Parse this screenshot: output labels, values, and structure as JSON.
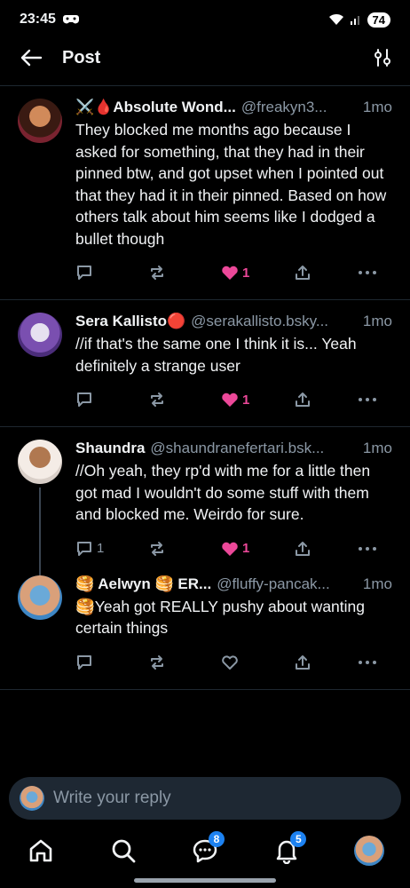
{
  "status": {
    "time": "23:45",
    "battery": "74"
  },
  "header": {
    "title": "Post"
  },
  "posts": [
    {
      "name": "⚔️🩸Absolute Wond...",
      "handle": "@freakyn3...",
      "time": "1mo",
      "text": "They blocked me months ago because I asked for something, that they had in their pinned btw, and got upset when I pointed out that they had it in their pinned. Based on how others talk about him seems like I dodged a bullet though",
      "reply_count": "",
      "like_count": "1",
      "liked": true
    },
    {
      "name": "Sera Kallisto🔴",
      "handle": "@serakallisto.bsky...",
      "time": "1mo",
      "text": "//if that's the same one I think it is... Yeah definitely a strange user",
      "reply_count": "",
      "like_count": "1",
      "liked": true
    },
    {
      "name": "Shaundra",
      "handle": "@shaundranefertari.bsk...",
      "time": "1mo",
      "text": "//Oh yeah, they rp'd with me for a little then got mad I wouldn't do some stuff with them and blocked me. Weirdo for sure.",
      "reply_count": "1",
      "like_count": "1",
      "liked": true
    },
    {
      "name": "🥞 Aelwyn 🥞 ER...",
      "handle": "@fluffy-pancak...",
      "time": "1mo",
      "text": "🥞Yeah got REALLY pushy about wanting certain things",
      "reply_count": "",
      "like_count": "",
      "liked": false
    }
  ],
  "reply": {
    "placeholder": "Write your reply"
  },
  "tabs": {
    "chat_badge": "8",
    "notif_badge": "5"
  },
  "colors": {
    "like": "#ec4899",
    "accent": "#1d82f1",
    "muted": "#8b98a5"
  }
}
